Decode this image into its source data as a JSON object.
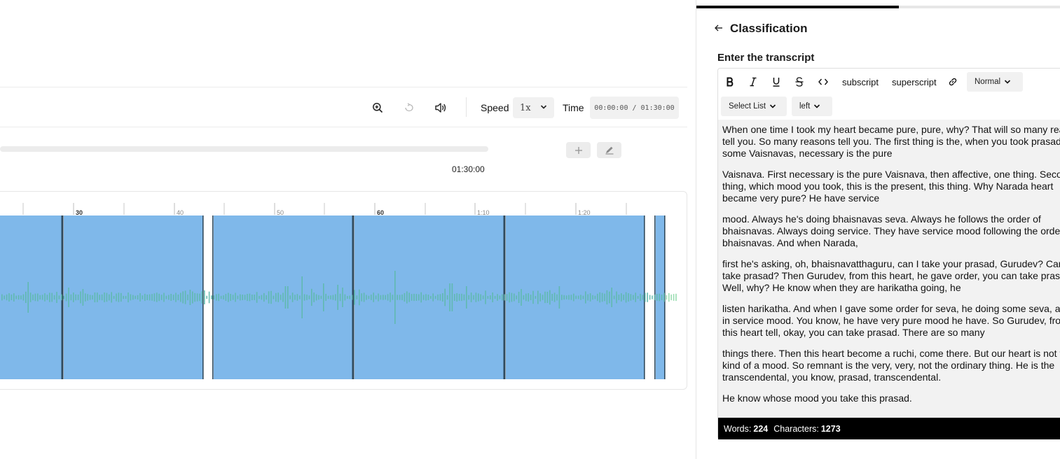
{
  "player": {
    "speed_label": "Speed",
    "speed_value": "1x",
    "time_label": "Time",
    "time_value": "00:00:00 / 01:30:00",
    "duration": "01:30:00",
    "progress": 0
  },
  "timeline": {
    "ticks": [
      "30",
      "40",
      "50",
      "60",
      "1:10",
      "1:20"
    ],
    "segment_color": "#7fb8ea",
    "boundary_color": "#2f4a5e",
    "wave_color": "#5fb9ad"
  },
  "panel": {
    "title": "Classification",
    "field_label": "Enter the transcript"
  },
  "editor": {
    "toolbar": {
      "subscript": "subscript",
      "superscript": "superscript",
      "heading_select": "Normal",
      "list_select": "Select List",
      "align_select": "left"
    },
    "paragraphs": [
      "When one time I took my heart became pure, pure, why? That will so many reasons tell you. So many reasons tell you. The first thing is the, when you took prasad to some Vaisnavas, necessary is the pure",
      "Vaisnava. First necessary is the pure Vaisnava, then affective, one thing. Second thing, which mood you took, this is the present, this thing. Why Narada heart became very pure? He have service",
      "mood. Always he's doing bhaisnavas seva. Always he follows the order of bhaisnavas. Always doing service. They have service mood following the order of bhaisnavas. And when Narada,",
      "first he's asking, oh, bhaisnavatthaguru, can I take your prasad, Gurudev? Can I take prasad? Then Gurudev, from this heart, he gave order, you can take prasad. Well, why? He know when they are harikatha going, he",
      "listen harikatha. And when I gave some order for seva, he doing some seva, always in service mood. You know, he have very pure mood he have. So Gurudev, from this heart tell, okay, you can take prasad. There are so many",
      "things there. Then this heart become a ruchi, come there. But our heart is not this kind of a mood. So remnant is the very, very, not the ordinary thing. He is the transcendental, you know, prasad, transcendental.",
      "He know whose mood you take this prasad."
    ],
    "stats": {
      "words_label": "Words:",
      "words": "224",
      "chars_label": "Characters:",
      "chars": "1273"
    }
  }
}
